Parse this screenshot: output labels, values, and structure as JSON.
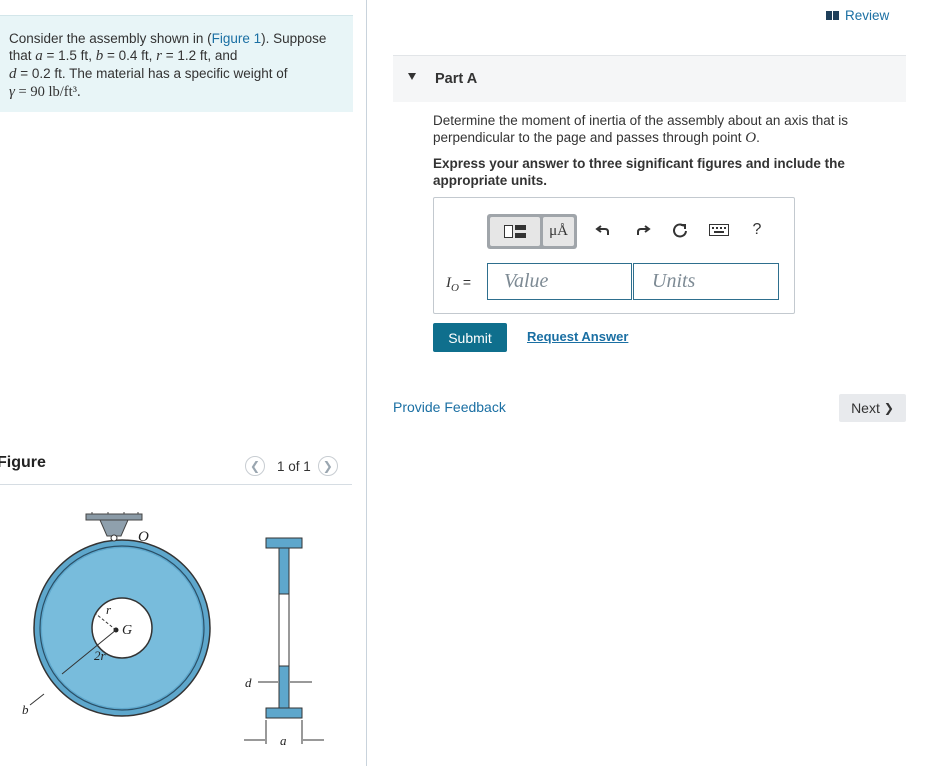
{
  "problem": {
    "intro": "Consider the assembly shown in (",
    "figure_link": "Figure 1",
    "after_link": "). Suppose",
    "line2_prefix": "that ",
    "a_var": "a",
    "a_val": " = 1.5  ft",
    "b_var": "b",
    "b_val": " = 0.4  ft",
    "r_var": "r",
    "r_val": " = 1.2  ft",
    "and": ", and",
    "d_var": "d",
    "d_val": " = 0.2  ft",
    "weight_text": ". The material has a specific weight of",
    "gamma_var": "γ",
    "gamma_val": " = 90 lb/ft³."
  },
  "figure": {
    "title": "Figure",
    "counter": "1 of 1",
    "labels": {
      "O": "O",
      "G": "G",
      "r": "r",
      "two_r": "2r",
      "b": "b",
      "d": "d",
      "a": "a"
    }
  },
  "review": {
    "label": "Review"
  },
  "partA": {
    "title": "Part A",
    "question": "Determine the moment of inertia of the assembly about an axis that is perpendicular to the page and passes through point ",
    "question_point": "O",
    "question_end": ".",
    "instruction": "Express your answer to three significant figures and include the appropriate units."
  },
  "answer": {
    "symbols_label": "μÅ",
    "help_label": "?",
    "io_label_sym": "I",
    "io_label_sub": "O",
    "io_label_eq": " =",
    "value_placeholder": "Value",
    "units_placeholder": "Units"
  },
  "actions": {
    "submit": "Submit",
    "request_answer": "Request Answer",
    "feedback": "Provide Feedback",
    "next": "Next",
    "next_icon": "❯"
  },
  "colors": {
    "accent": "#0f6f8d",
    "link": "#1a6fa3",
    "disk": "#6fb3d2",
    "problem_bg": "#e8f5f7"
  }
}
